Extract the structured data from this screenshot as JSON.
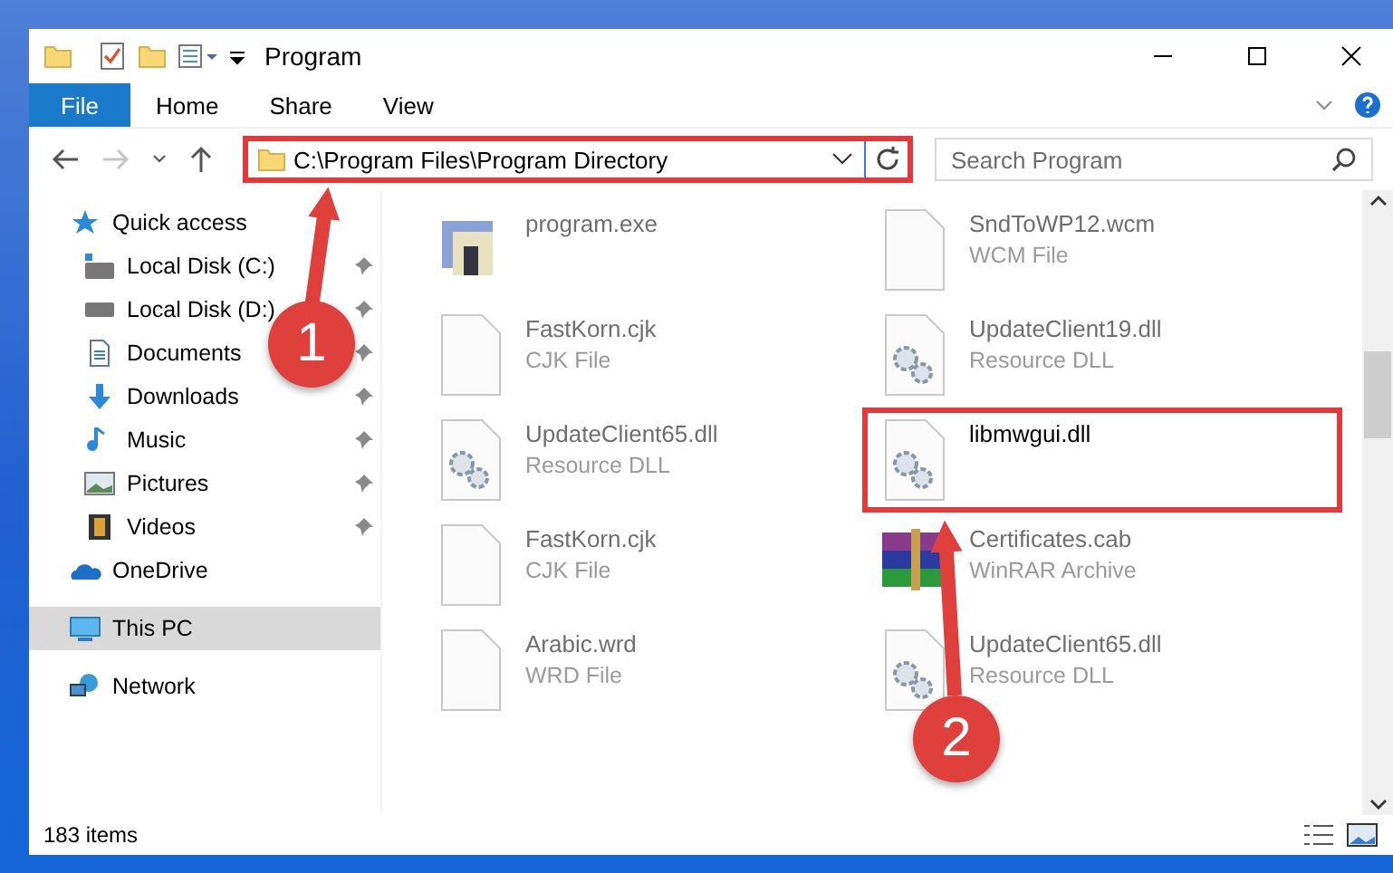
{
  "window": {
    "title": "Program"
  },
  "ribbon": {
    "tabs": [
      {
        "label": "File",
        "selected": true
      },
      {
        "label": "Home",
        "selected": false
      },
      {
        "label": "Share",
        "selected": false
      },
      {
        "label": "View",
        "selected": false
      }
    ]
  },
  "address": {
    "path": "C:\\Program Files\\Program Directory",
    "highlighted": true
  },
  "search": {
    "placeholder": "Search Program"
  },
  "nav": [
    {
      "label": "Quick access",
      "kind": "star",
      "selected": false,
      "children": [
        {
          "label": "Local Disk (C:)",
          "kind": "sysdrive",
          "pinned": true,
          "selected": false
        },
        {
          "label": "Local Disk (D:)",
          "kind": "drive",
          "pinned": true,
          "selected": false
        },
        {
          "label": "Documents",
          "kind": "documents",
          "pinned": true,
          "selected": false
        },
        {
          "label": "Downloads",
          "kind": "downloads",
          "pinned": true,
          "selected": false
        },
        {
          "label": "Music",
          "kind": "music",
          "pinned": true,
          "selected": false
        },
        {
          "label": "Pictures",
          "kind": "pictures",
          "pinned": true,
          "selected": false
        },
        {
          "label": "Videos",
          "kind": "videos",
          "pinned": true,
          "selected": false
        }
      ]
    },
    {
      "label": "OneDrive",
      "kind": "cloud",
      "selected": false
    },
    {
      "label": "This PC",
      "kind": "pc",
      "selected": true
    },
    {
      "label": "Network",
      "kind": "network",
      "selected": false
    }
  ],
  "files": [
    {
      "name": "program.exe",
      "kind": "exe",
      "faded": true,
      "highlighted": false
    },
    {
      "name": "SndToWP12.wcm",
      "type": "WCM File",
      "kind": "blank",
      "faded": true,
      "highlighted": false
    },
    {
      "name": "FastKorn.cjk",
      "type": "CJK File",
      "kind": "blank",
      "faded": true,
      "highlighted": false
    },
    {
      "name": "UpdateClient19.dll",
      "type": "Resource DLL",
      "kind": "dll",
      "faded": true,
      "highlighted": false
    },
    {
      "name": "UpdateClient65.dll",
      "type": "Resource DLL",
      "kind": "dll",
      "faded": true,
      "highlighted": false
    },
    {
      "name": "libmwgui.dll",
      "kind": "dll",
      "faded": false,
      "highlighted": true
    },
    {
      "name": "FastKorn.cjk",
      "type": "CJK File",
      "kind": "blank",
      "faded": true,
      "highlighted": false
    },
    {
      "name": "Certificates.cab",
      "type": "WinRAR Archive",
      "kind": "archive",
      "faded": true,
      "highlighted": false
    },
    {
      "name": "Arabic.wrd",
      "type": "WRD File",
      "kind": "blank",
      "faded": true,
      "highlighted": false
    },
    {
      "name": "UpdateClient65.dll",
      "type": "Resource DLL",
      "kind": "dll",
      "faded": true,
      "highlighted": false
    }
  ],
  "status_bar": {
    "item_count": "183 items"
  },
  "callouts": [
    {
      "number": "1"
    },
    {
      "number": "2"
    }
  ]
}
